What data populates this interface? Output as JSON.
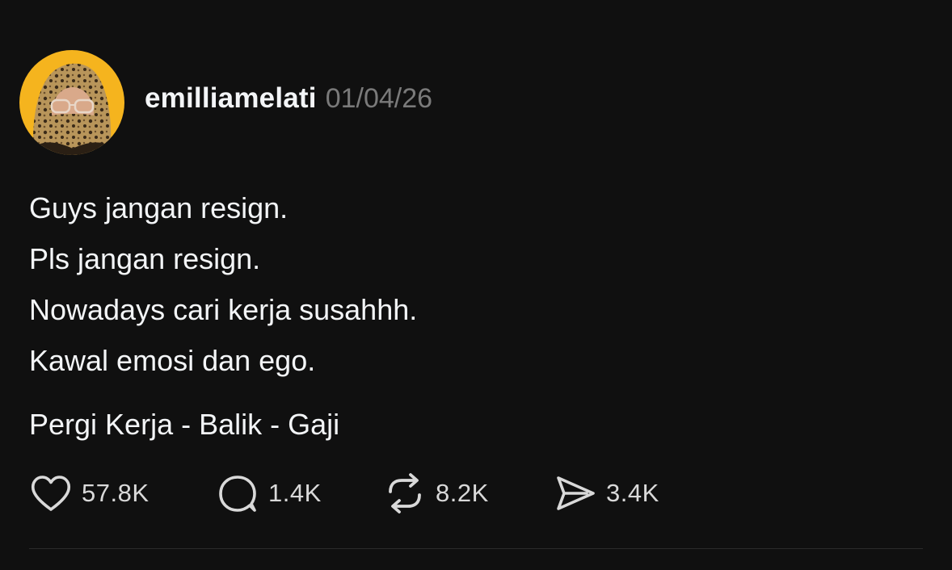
{
  "post": {
    "author": {
      "username": "emilliamelati",
      "avatar_icon": "avatar-photo",
      "avatar_bg": "#f5b41e"
    },
    "timestamp": "01/04/26",
    "lines": [
      "Guys jangan resign.",
      "Pls jangan resign.",
      "Nowadays cari kerja susahhh.",
      "Kawal emosi dan ego."
    ],
    "tagline": "Pergi Kerja - Balik - Gaji",
    "actions": {
      "like": {
        "icon": "heart-icon",
        "count": "57.8K"
      },
      "reply": {
        "icon": "comment-icon",
        "count": "1.4K"
      },
      "repost": {
        "icon": "repost-icon",
        "count": "8.2K"
      },
      "share": {
        "icon": "send-icon",
        "count": "3.4K"
      }
    }
  },
  "theme": {
    "background": "#101010",
    "text": "#f3f5f7",
    "muted": "#7a7a7a"
  }
}
